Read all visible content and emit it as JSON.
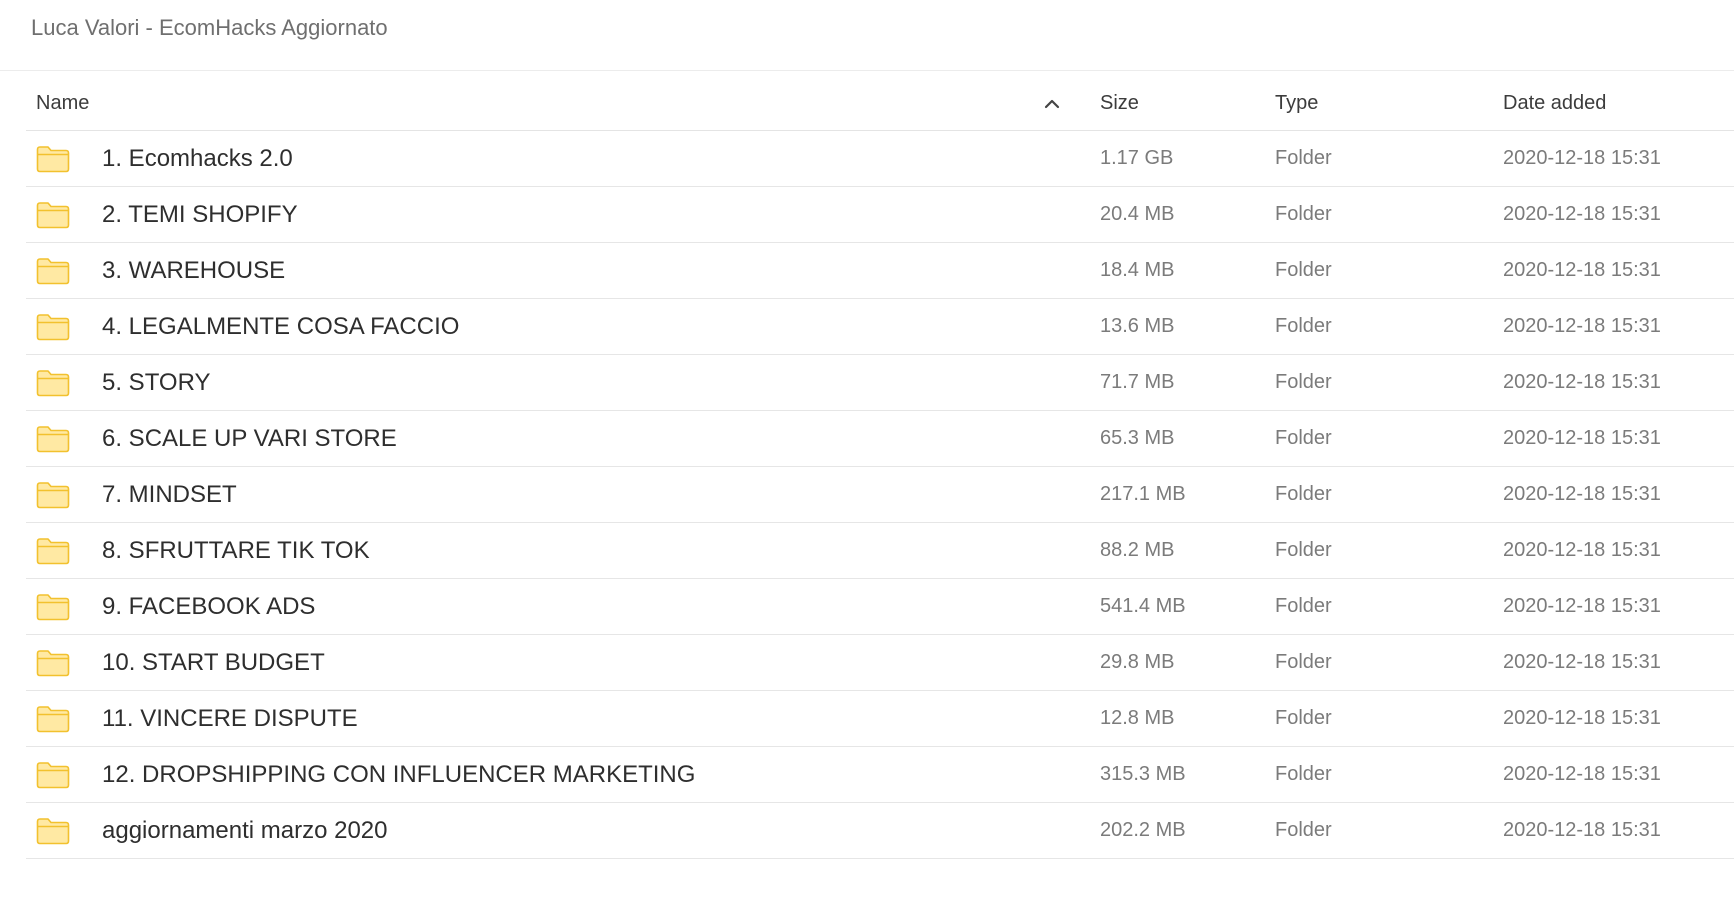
{
  "breadcrumb": "Luca Valori - EcomHacks Aggiornato",
  "columns": {
    "name": "Name",
    "size": "Size",
    "type": "Type",
    "date": "Date added",
    "sort_icon": "chevron-up-icon"
  },
  "colors": {
    "folder_fill": "#FFE9A3",
    "folder_stroke": "#F2C12E"
  },
  "rows": [
    {
      "icon": "folder-icon",
      "name": "1. Ecomhacks 2.0",
      "size": "1.17 GB",
      "type": "Folder",
      "date": "2020-12-18 15:31"
    },
    {
      "icon": "folder-icon",
      "name": "2. TEMI SHOPIFY",
      "size": "20.4 MB",
      "type": "Folder",
      "date": "2020-12-18 15:31"
    },
    {
      "icon": "folder-icon",
      "name": "3. WAREHOUSE",
      "size": "18.4 MB",
      "type": "Folder",
      "date": "2020-12-18 15:31"
    },
    {
      "icon": "folder-icon",
      "name": "4. LEGALMENTE COSA FACCIO",
      "size": "13.6 MB",
      "type": "Folder",
      "date": "2020-12-18 15:31"
    },
    {
      "icon": "folder-icon",
      "name": "5. STORY",
      "size": "71.7 MB",
      "type": "Folder",
      "date": "2020-12-18 15:31"
    },
    {
      "icon": "folder-icon",
      "name": "6. SCALE UP VARI STORE",
      "size": "65.3 MB",
      "type": "Folder",
      "date": "2020-12-18 15:31"
    },
    {
      "icon": "folder-icon",
      "name": "7. MINDSET",
      "size": "217.1 MB",
      "type": "Folder",
      "date": "2020-12-18 15:31"
    },
    {
      "icon": "folder-icon",
      "name": "8. SFRUTTARE TIK TOK",
      "size": "88.2 MB",
      "type": "Folder",
      "date": "2020-12-18 15:31"
    },
    {
      "icon": "folder-icon",
      "name": "9. FACEBOOK ADS",
      "size": "541.4 MB",
      "type": "Folder",
      "date": "2020-12-18 15:31"
    },
    {
      "icon": "folder-icon",
      "name": "10. START BUDGET",
      "size": "29.8 MB",
      "type": "Folder",
      "date": "2020-12-18 15:31"
    },
    {
      "icon": "folder-icon",
      "name": "11. VINCERE DISPUTE",
      "size": "12.8 MB",
      "type": "Folder",
      "date": "2020-12-18 15:31"
    },
    {
      "icon": "folder-icon",
      "name": "12. DROPSHIPPING CON INFLUENCER MARKETING",
      "size": "315.3 MB",
      "type": "Folder",
      "date": "2020-12-18 15:31"
    },
    {
      "icon": "folder-icon",
      "name": "aggiornamenti marzo 2020",
      "size": "202.2 MB",
      "type": "Folder",
      "date": "2020-12-18 15:31"
    }
  ]
}
